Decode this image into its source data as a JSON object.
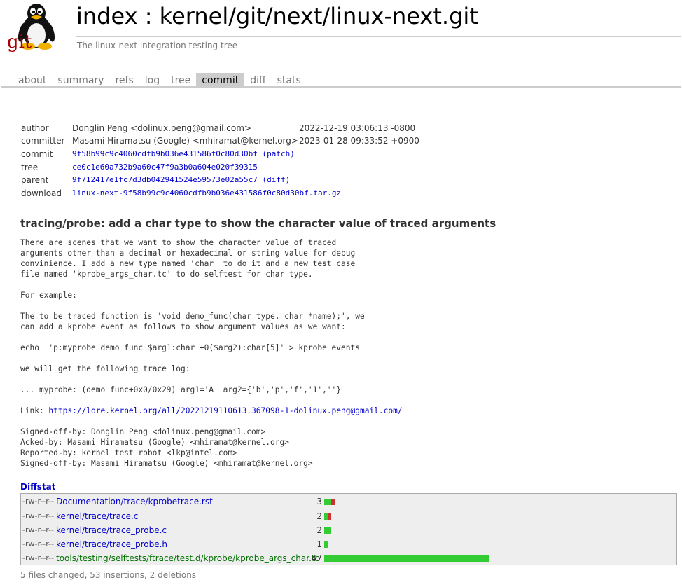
{
  "header": {
    "logo_text": "git",
    "title": "index : kernel/git/next/linux-next.git",
    "description": "The linux-next integration testing tree"
  },
  "tabs": [
    {
      "label": "about",
      "active": false
    },
    {
      "label": "summary",
      "active": false
    },
    {
      "label": "refs",
      "active": false
    },
    {
      "label": "log",
      "active": false
    },
    {
      "label": "tree",
      "active": false
    },
    {
      "label": "commit",
      "active": true
    },
    {
      "label": "diff",
      "active": false
    },
    {
      "label": "stats",
      "active": false
    }
  ],
  "commit_info": {
    "author_label": "author",
    "author": "Donglin Peng <dolinux.peng@gmail.com>",
    "author_date": "2022-12-19 03:06:13 -0800",
    "committer_label": "committer",
    "committer": "Masami Hiramatsu (Google) <mhiramat@kernel.org>",
    "committer_date": "2023-01-28 09:33:52 +0900",
    "commit_label": "commit",
    "commit_hash": "9f58b99c9c4060cdfb9b036e431586f0c80d30bf",
    "commit_extra": "(patch)",
    "tree_label": "tree",
    "tree_hash": "ce0c1e60a732b9a60c47f9a3b0a604e020f39315",
    "parent_label": "parent",
    "parent_hash": "9f712417e1fc7d3db042941524e59573e02a55c7",
    "parent_extra": "(diff)",
    "download_label": "download",
    "download_file": "linux-next-9f58b99c9c4060cdfb9b036e431586f0c80d30bf.tar.gz"
  },
  "subject": "tracing/probe: add a char type to show the character value of traced arguments",
  "message": {
    "body_1": "There are scenes that we want to show the character value of traced\narguments other than a decimal or hexadecimal or string value for debug\nconvinience. I add a new type named 'char' to do it and a new test case\nfile named 'kprobe_args_char.tc' to do selftest for char type.\n\nFor example:\n\nThe to be traced function is 'void demo_func(char type, char *name);', we\ncan add a kprobe event as follows to show argument values as we want:\n\necho  'p:myprobe demo_func $arg1:char +0($arg2):char[5]' > kprobe_events\n\nwe will get the following trace log:\n\n... myprobe: (demo_func+0x0/0x29) arg1='A' arg2={'b','p','f','1',''}\n\n",
    "link_label": "Link: ",
    "link_url": "https://lore.kernel.org/all/20221219110613.367098-1-dolinux.peng@gmail.com/",
    "body_2": "\n\nSigned-off-by: Donglin Peng <dolinux.peng@gmail.com>\nAcked-by: Masami Hiramatsu (Google) <mhiramat@kernel.org>\nReported-by: kernel test robot <lkp@intel.com>\nSigned-off-by: Masami Hiramatsu (Google) <mhiramat@kernel.org>"
  },
  "diffstat": {
    "heading": "Diffstat",
    "files": [
      {
        "mode": "-rw-r--r--",
        "path": "Documentation/trace/kprobetrace.rst",
        "count": "3",
        "insertions": 2,
        "deletions": 1,
        "new": false
      },
      {
        "mode": "-rw-r--r--",
        "path": "kernel/trace/trace.c",
        "count": "2",
        "insertions": 1,
        "deletions": 1,
        "new": false
      },
      {
        "mode": "-rw-r--r--",
        "path": "kernel/trace/trace_probe.c",
        "count": "2",
        "insertions": 2,
        "deletions": 0,
        "new": false
      },
      {
        "mode": "-rw-r--r--",
        "path": "kernel/trace/trace_probe.h",
        "count": "1",
        "insertions": 1,
        "deletions": 0,
        "new": false
      },
      {
        "mode": "-rw-r--r--",
        "path": "tools/testing/selftests/ftrace/test.d/kprobe/kprobe_args_char.tc",
        "count": "47",
        "insertions": 47,
        "deletions": 0,
        "new": true
      }
    ],
    "summary": "5 files changed, 53 insertions, 2 deletions",
    "colors": {
      "insert": "#33cc33",
      "delete": "#cc3333"
    }
  }
}
